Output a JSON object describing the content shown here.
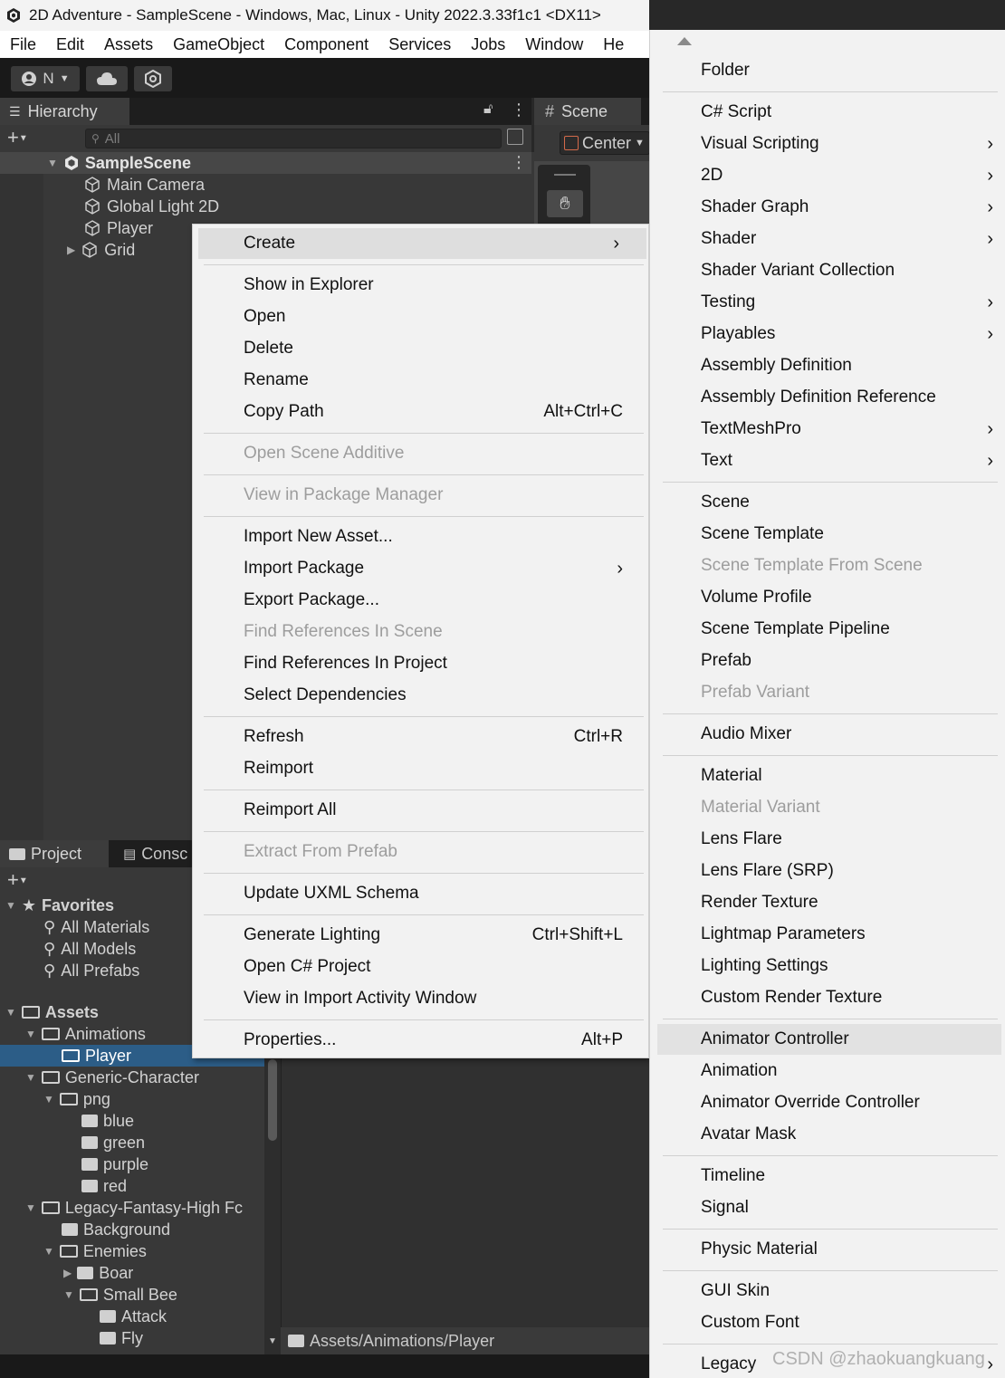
{
  "window": {
    "title": "2D Adventure - SampleScene - Windows, Mac, Linux - Unity 2022.3.33f1c1 <DX11>"
  },
  "menubar": {
    "items": [
      "File",
      "Edit",
      "Assets",
      "GameObject",
      "Component",
      "Services",
      "Jobs",
      "Window",
      "He"
    ]
  },
  "toolbar": {
    "account_label": "N"
  },
  "hierarchy": {
    "tab_label": "Hierarchy",
    "search_placeholder": "All",
    "scene_name": "SampleScene",
    "items": [
      "Main Camera",
      "Global Light 2D",
      "Player",
      "Grid"
    ]
  },
  "scene": {
    "tab_label": "Scene",
    "pivot_label": "Center"
  },
  "project": {
    "tab_label": "Project",
    "console_tab_label": "Consc",
    "favorites": {
      "label": "Favorites",
      "items": [
        "All Materials",
        "All Models",
        "All Prefabs"
      ]
    },
    "assets_label": "Assets",
    "tree": [
      "Animations",
      "Player",
      "Generic-Character",
      "png",
      "blue",
      "green",
      "purple",
      "red",
      "Legacy-Fantasy-High Fc",
      "Background",
      "Enemies",
      "Boar",
      "Small Bee",
      "Attack",
      "Fly"
    ],
    "path": "Assets/Animations/Player"
  },
  "context_menu": {
    "create": "Create",
    "show_in_explorer": "Show in Explorer",
    "open": "Open",
    "delete": "Delete",
    "rename": "Rename",
    "copy_path": "Copy Path",
    "copy_path_shortcut": "Alt+Ctrl+C",
    "open_scene_additive": "Open Scene Additive",
    "view_in_package_manager": "View in Package Manager",
    "import_new_asset": "Import New Asset...",
    "import_package": "Import Package",
    "export_package": "Export Package...",
    "find_refs_scene": "Find References In Scene",
    "find_refs_project": "Find References In Project",
    "select_dependencies": "Select Dependencies",
    "refresh": "Refresh",
    "refresh_shortcut": "Ctrl+R",
    "reimport": "Reimport",
    "reimport_all": "Reimport All",
    "extract_from_prefab": "Extract From Prefab",
    "update_uxml_schema": "Update UXML Schema",
    "generate_lighting": "Generate Lighting",
    "generate_lighting_shortcut": "Ctrl+Shift+L",
    "open_csharp_project": "Open C# Project",
    "view_import_activity": "View in Import Activity Window",
    "properties": "Properties...",
    "properties_shortcut": "Alt+P"
  },
  "create_submenu": {
    "folder": "Folder",
    "csharp_script": "C# Script",
    "visual_scripting": "Visual Scripting",
    "two_d": "2D",
    "shader_graph": "Shader Graph",
    "shader": "Shader",
    "shader_variant_collection": "Shader Variant Collection",
    "testing": "Testing",
    "playables": "Playables",
    "assembly_definition": "Assembly Definition",
    "assembly_definition_reference": "Assembly Definition Reference",
    "textmeshpro": "TextMeshPro",
    "text": "Text",
    "scene": "Scene",
    "scene_template": "Scene Template",
    "scene_template_from_scene": "Scene Template From Scene",
    "volume_profile": "Volume Profile",
    "scene_template_pipeline": "Scene Template Pipeline",
    "prefab": "Prefab",
    "prefab_variant": "Prefab Variant",
    "audio_mixer": "Audio Mixer",
    "material": "Material",
    "material_variant": "Material Variant",
    "lens_flare": "Lens Flare",
    "lens_flare_srp": "Lens Flare (SRP)",
    "render_texture": "Render Texture",
    "lightmap_parameters": "Lightmap Parameters",
    "lighting_settings": "Lighting Settings",
    "custom_render_texture": "Custom Render Texture",
    "animator_controller": "Animator Controller",
    "animation": "Animation",
    "animator_override_controller": "Animator Override Controller",
    "avatar_mask": "Avatar Mask",
    "timeline": "Timeline",
    "signal": "Signal",
    "physic_material": "Physic Material",
    "gui_skin": "GUI Skin",
    "custom_font": "Custom Font",
    "legacy": "Legacy"
  },
  "watermark": "CSDN @zhaokuangkuang",
  "colors": {
    "accent_selection": "#2c5d87",
    "menu_bg": "#f2f2f2",
    "editor_bg": "#383838"
  }
}
